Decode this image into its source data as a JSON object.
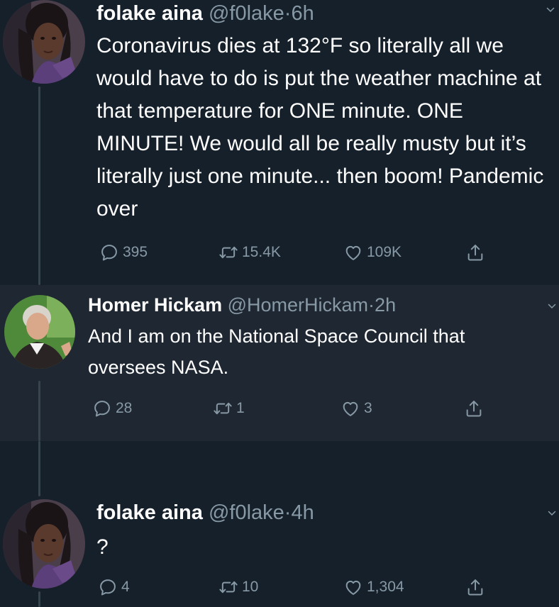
{
  "tweets": [
    {
      "name": "folake aina",
      "handle": "@f0lake",
      "dot": "·",
      "time": "6h",
      "text": "Coronavirus dies at 132°F so literally all we would have to do is put the weather machine at that temperature for ONE minute. ONE MINUTE! We would all be really musty but it’s literally just one minute... then boom! Pandemic over",
      "replies": "395",
      "retweets": "15.4K",
      "likes": "109K"
    },
    {
      "name": "Homer Hickam",
      "handle": "@HomerHickam",
      "dot": "·",
      "time": "2h",
      "text": "And I am on the National Space Council that oversees NASA.",
      "replies": "28",
      "retweets": "1",
      "likes": "3"
    },
    {
      "name": "folake aina",
      "handle": "@f0lake",
      "dot": "·",
      "time": "4h",
      "text": "?",
      "replies": "4",
      "retweets": "10",
      "likes": "1,304"
    }
  ],
  "icons": {
    "reply": "reply-icon",
    "retweet": "retweet-icon",
    "like": "heart-icon",
    "share": "share-icon",
    "caret": "chevron-down-icon"
  },
  "colors": {
    "background": "#15202b",
    "highlighted_background": "#1e2732",
    "text": "#ffffff",
    "secondary_text": "#8899a6",
    "thread_line": "#38444d"
  }
}
